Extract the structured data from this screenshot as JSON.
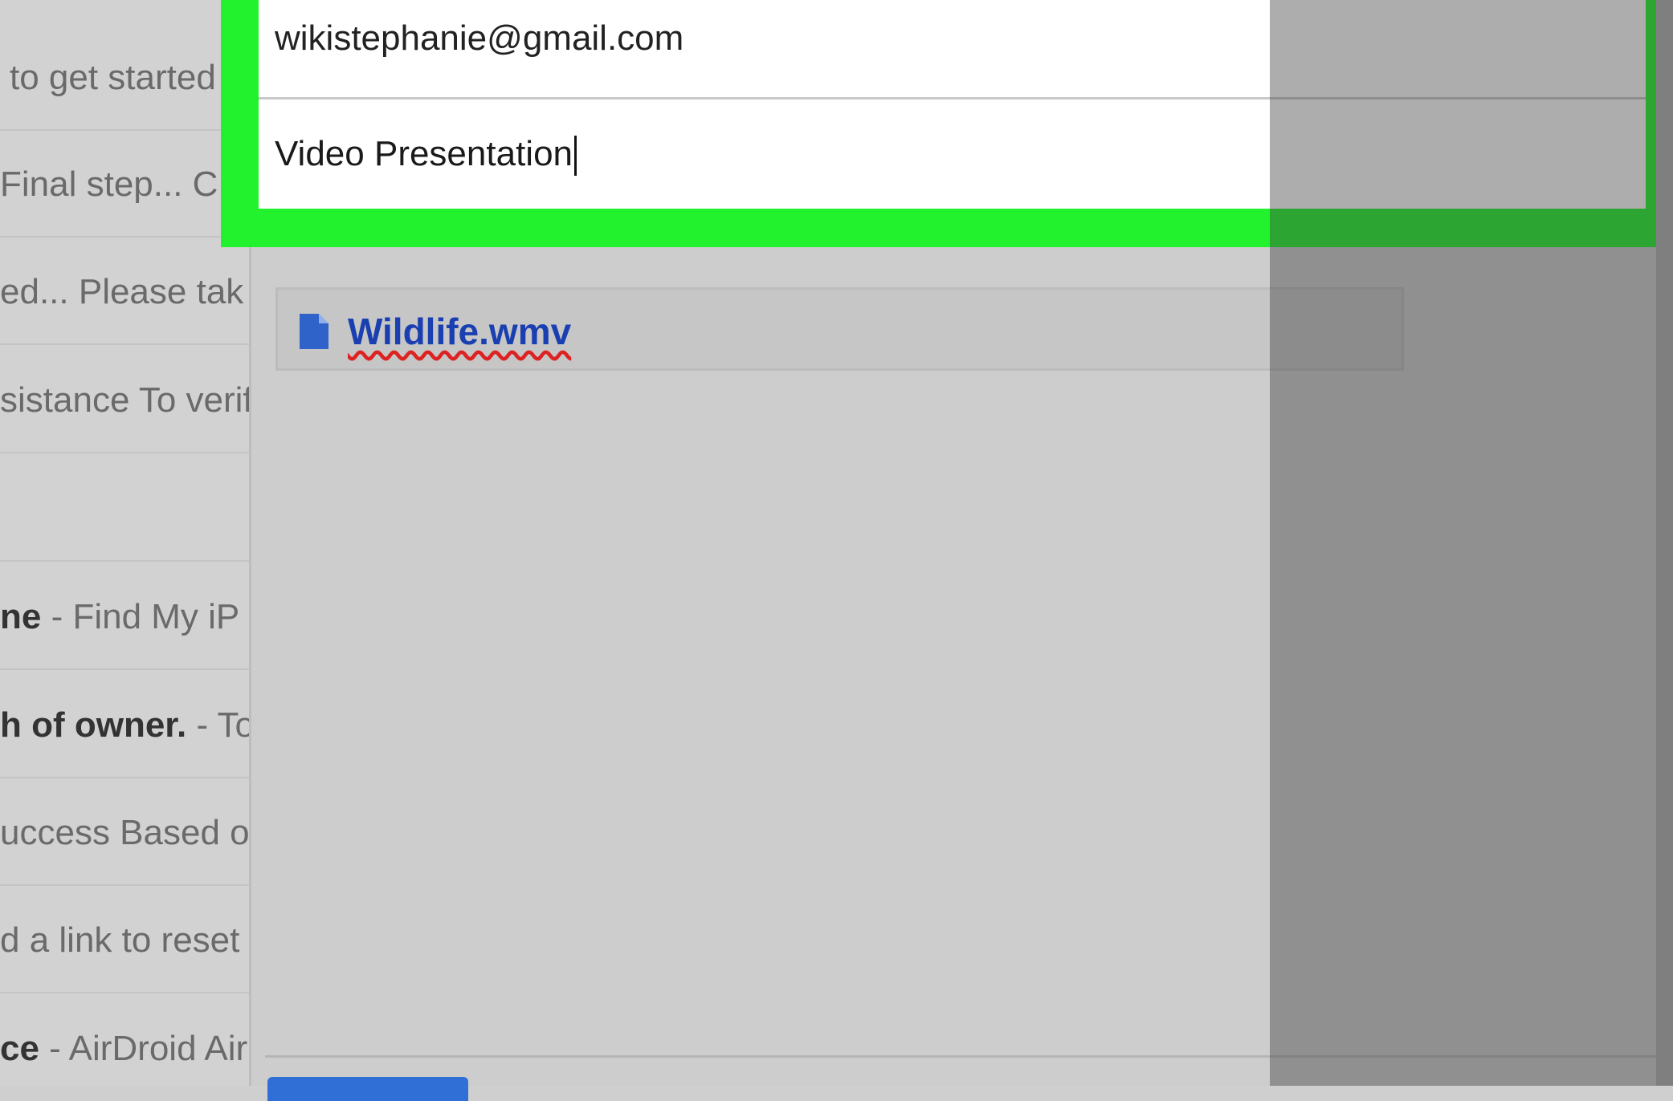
{
  "inbox": {
    "rows": [
      {
        "sender": "",
        "snippet": "to get started"
      },
      {
        "sender": "",
        "snippet": "Final step... C"
      },
      {
        "sender": "",
        "snippet": "ed... Please tak"
      },
      {
        "sender": "",
        "snippet": "sistance To verif"
      },
      {
        "sender": "",
        "snippet": ""
      },
      {
        "sender": "ne",
        "snippet": " - Find My iP"
      },
      {
        "sender": "h of owner.",
        "snippet": " - To"
      },
      {
        "sender": "",
        "snippet": "uccess Based o"
      },
      {
        "sender": "",
        "snippet": "d a link to reset"
      },
      {
        "sender": "ce",
        "snippet": " - AirDroid Air"
      }
    ]
  },
  "compose": {
    "to_value": "wikistephanie@gmail.com",
    "subject_value": "Video Presentation",
    "attachment": {
      "file_name": "Wildlife.wmv",
      "icon": "file-icon"
    }
  },
  "colors": {
    "highlight": "#22f22e",
    "link": "#1a3fb0",
    "send_button": "#2f6fd6"
  }
}
